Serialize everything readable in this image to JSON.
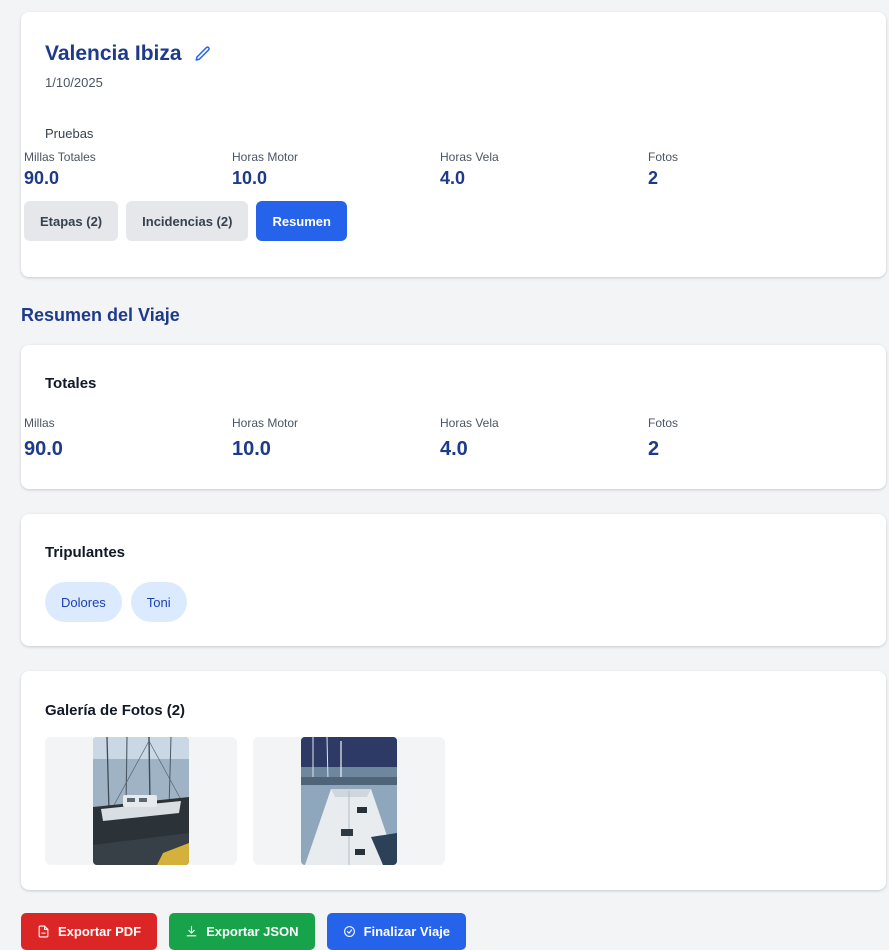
{
  "trip": {
    "title": "Valencia Ibiza",
    "date": "1/10/2025",
    "notes": "Pruebas",
    "stats": [
      {
        "label": "Millas Totales",
        "value": "90.0"
      },
      {
        "label": "Horas Motor",
        "value": "10.0"
      },
      {
        "label": "Horas Vela",
        "value": "4.0"
      },
      {
        "label": "Fotos",
        "value": "2"
      }
    ],
    "tabs": [
      {
        "label": "Etapas (2)",
        "active": false
      },
      {
        "label": "Incidencias (2)",
        "active": false
      },
      {
        "label": "Resumen",
        "active": true
      }
    ]
  },
  "summary": {
    "heading": "Resumen del Viaje",
    "totals": {
      "title": "Totales",
      "stats": [
        {
          "label": "Millas",
          "value": "90.0"
        },
        {
          "label": "Horas Motor",
          "value": "10.0"
        },
        {
          "label": "Horas Vela",
          "value": "4.0"
        },
        {
          "label": "Fotos",
          "value": "2"
        }
      ]
    },
    "crew": {
      "title": "Tripulantes",
      "members": [
        "Dolores",
        "Toni"
      ]
    },
    "gallery": {
      "title": "Galería de Fotos (2)",
      "photos": [
        "sailboat-deck-photo",
        "sailboat-bow-photo"
      ]
    }
  },
  "actions": {
    "export_pdf": "Exportar PDF",
    "export_json": "Exportar JSON",
    "finish_trip": "Finalizar Viaje"
  },
  "colors": {
    "primary": "#2563eb",
    "title": "#1e3a8a",
    "danger": "#dc2626",
    "success": "#16a34a",
    "chip_bg": "#dbeafe"
  },
  "icons": {
    "edit": "pencil-icon",
    "pdf": "file-pdf-icon",
    "json": "download-icon",
    "finish": "check-circle-icon"
  }
}
